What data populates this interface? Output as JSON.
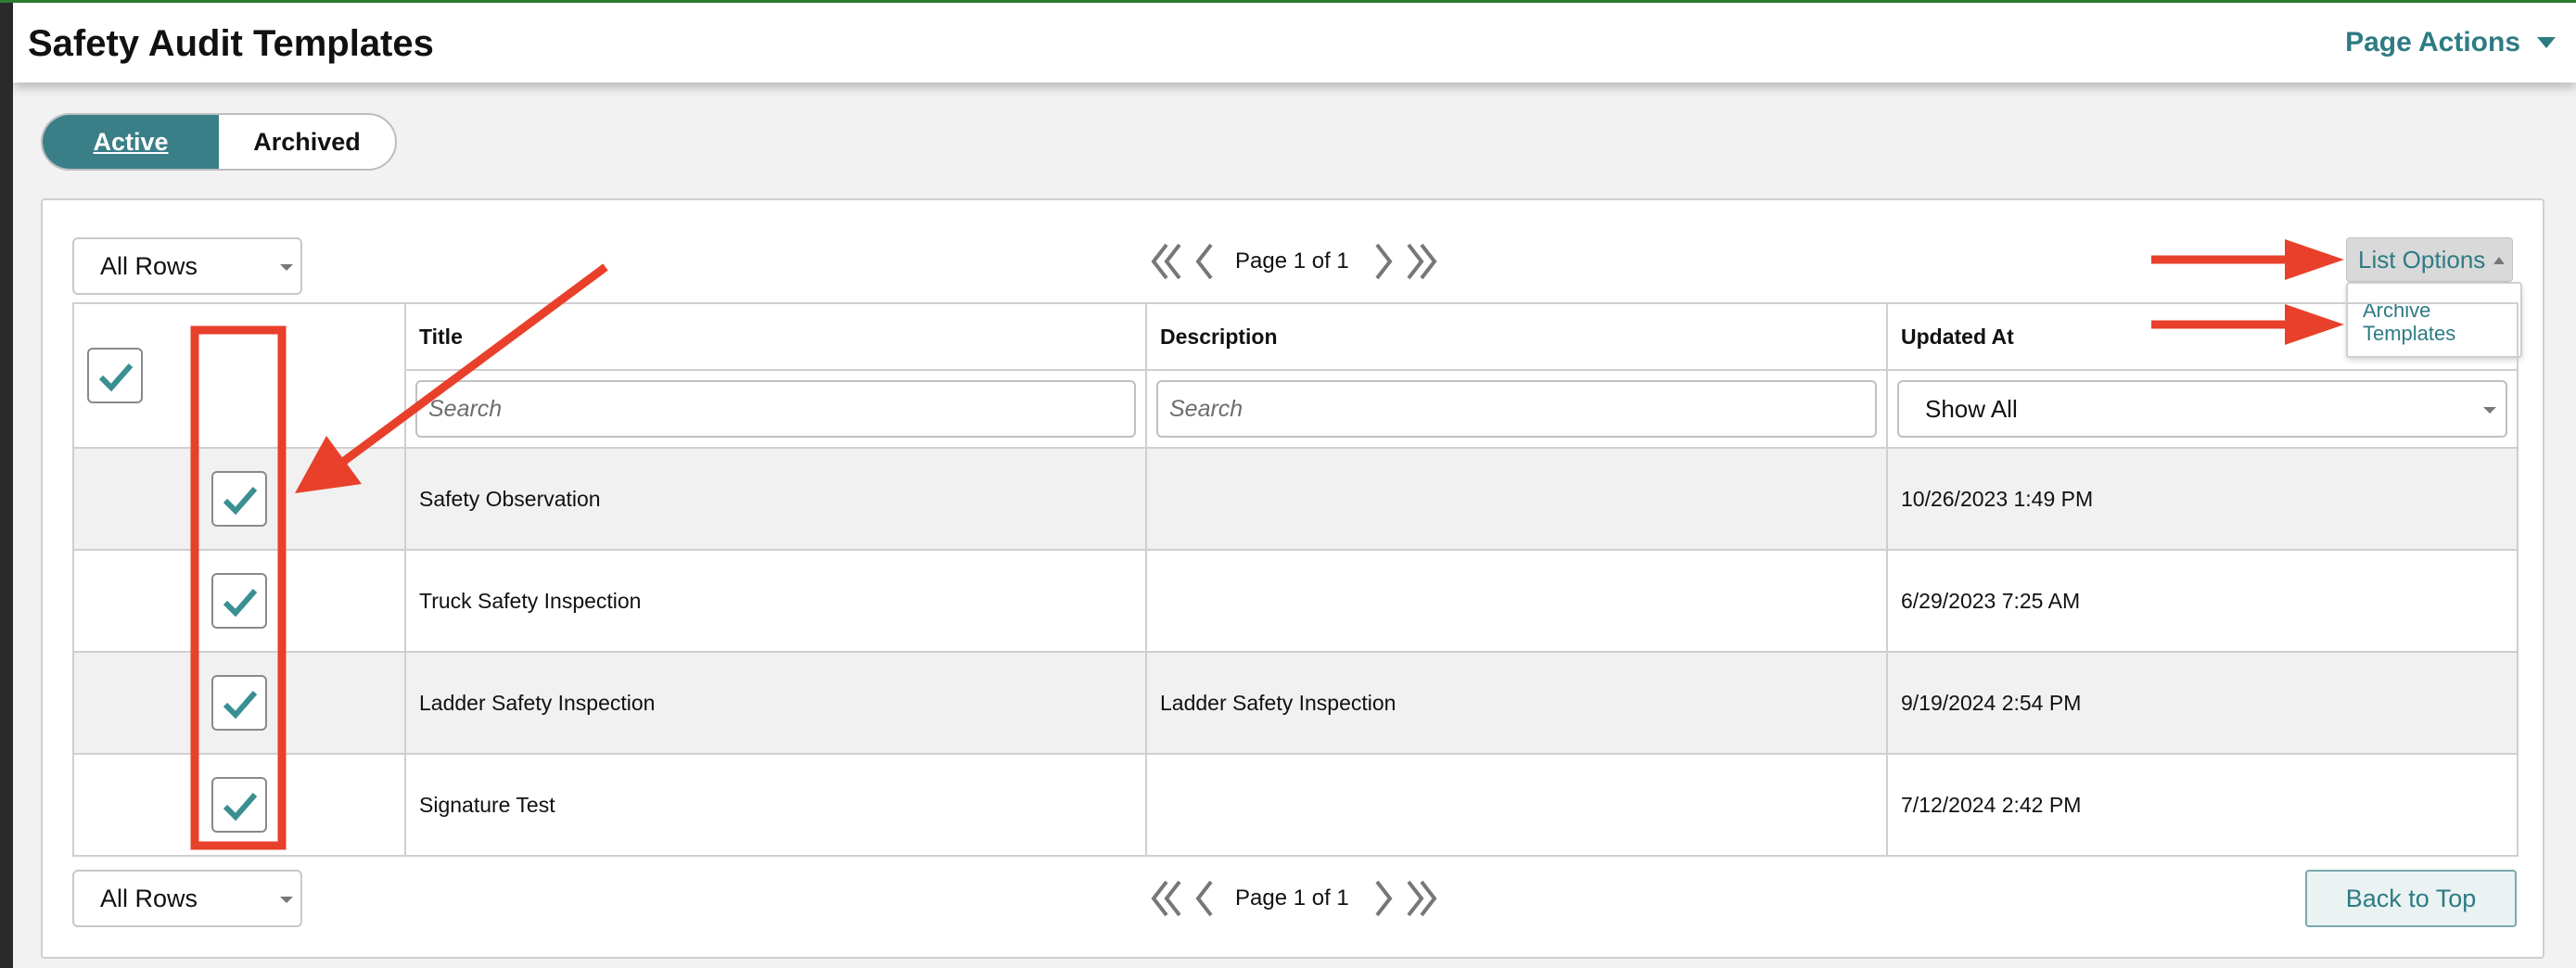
{
  "header": {
    "title": "Safety Audit Templates",
    "page_actions_label": "Page Actions"
  },
  "status_tabs": [
    {
      "label": "Active",
      "selected": true
    },
    {
      "label": "Archived",
      "selected": false
    }
  ],
  "top_controls": {
    "rows_select": "All Rows",
    "pager_text": "Page 1 of 1",
    "list_options_label": "List Options",
    "list_options_menu": [
      "Archive Templates"
    ]
  },
  "table": {
    "columns": [
      "",
      "Title",
      "Description",
      "Updated At"
    ],
    "filters": {
      "title_placeholder": "Search",
      "description_placeholder": "Search",
      "updated_at_value": "Show All"
    },
    "header_checked": true,
    "rows": [
      {
        "checked": true,
        "title": "Safety Observation",
        "description": "",
        "updated_at": "10/26/2023 1:49 PM"
      },
      {
        "checked": true,
        "title": "Truck Safety Inspection",
        "description": "",
        "updated_at": "6/29/2023 7:25 AM"
      },
      {
        "checked": true,
        "title": "Ladder Safety Inspection",
        "description": "Ladder Safety Inspection",
        "updated_at": "9/19/2024 2:54 PM"
      },
      {
        "checked": true,
        "title": "Signature Test",
        "description": "",
        "updated_at": "7/12/2024 2:42 PM"
      }
    ]
  },
  "bottom_controls": {
    "rows_select": "All Rows",
    "pager_text": "Page 1 of 1",
    "back_to_top_label": "Back to Top"
  },
  "icons": {
    "check": "check-icon",
    "first_page": "double-chevron-left-icon",
    "prev_page": "chevron-left-icon",
    "next_page": "chevron-right-icon",
    "last_page": "double-chevron-right-icon",
    "dropdown": "caret-down-icon"
  },
  "colors": {
    "accent": "#3a7f87",
    "link": "#2e7b84",
    "annotation": "#e8402a"
  }
}
